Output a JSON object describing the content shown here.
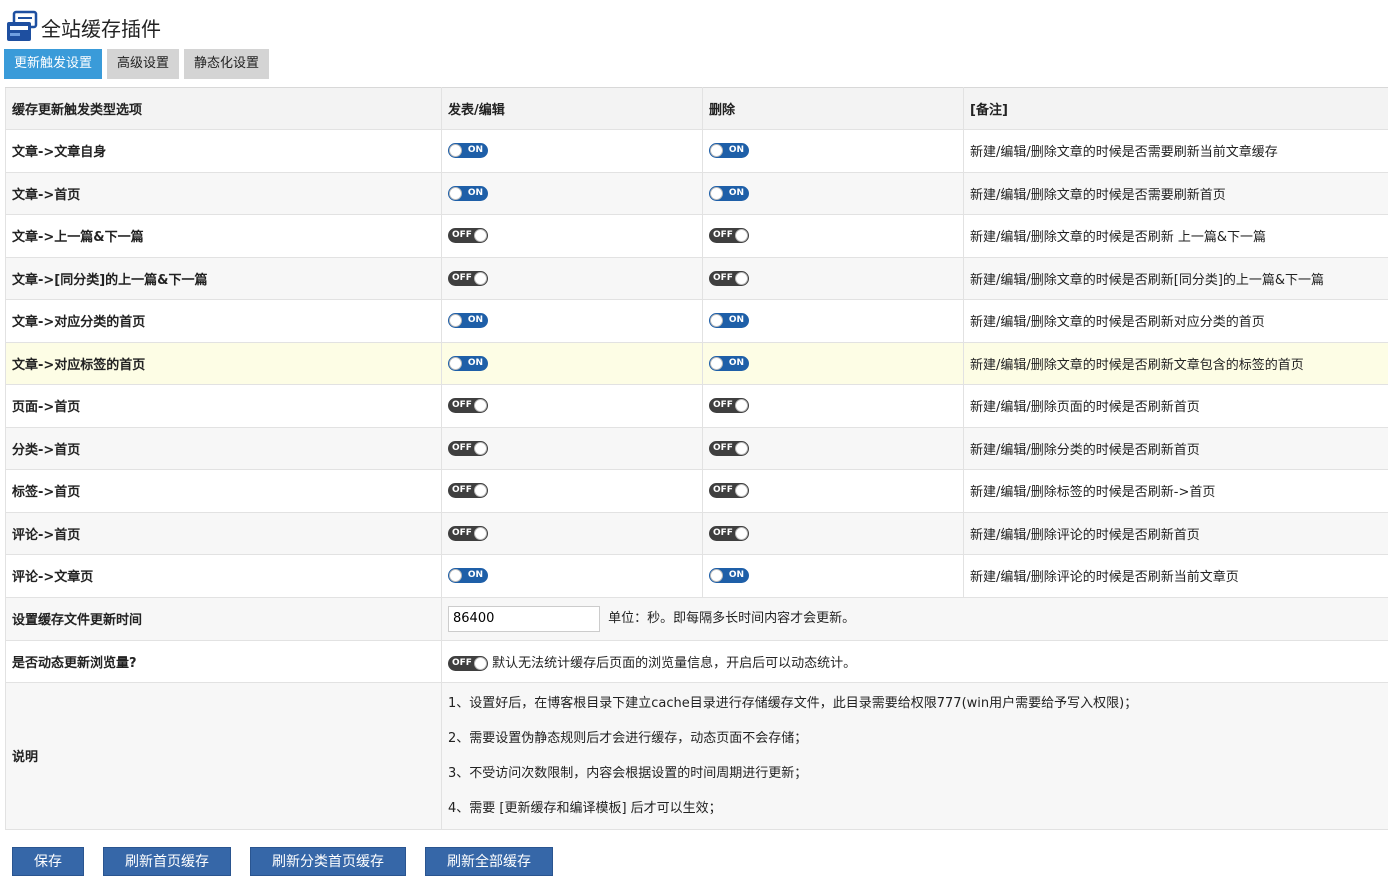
{
  "header": {
    "title": "全站缓存插件",
    "logo_icon": "cache-logo-icon"
  },
  "tabs": [
    {
      "label": "更新触发设置",
      "active": true
    },
    {
      "label": "高级设置",
      "active": false
    },
    {
      "label": "静态化设置",
      "active": false
    }
  ],
  "table": {
    "columns": [
      "缓存更新触发类型选项",
      "发表/编辑",
      "删除",
      "[备注]"
    ],
    "rows": [
      {
        "label": "文章->文章自身",
        "publish": "ON",
        "delete": "ON",
        "note": "新建/编辑/删除文章的时候是否需要刷新当前文章缓存"
      },
      {
        "label": "文章->首页",
        "publish": "ON",
        "delete": "ON",
        "note": "新建/编辑/删除文章的时候是否需要刷新首页"
      },
      {
        "label": "文章->上一篇&下一篇",
        "publish": "OFF",
        "delete": "OFF",
        "note": "新建/编辑/删除文章的时候是否刷新 上一篇&下一篇"
      },
      {
        "label": "文章->[同分类]的上一篇&下一篇",
        "publish": "OFF",
        "delete": "OFF",
        "note": "新建/编辑/删除文章的时候是否刷新[同分类]的上一篇&下一篇"
      },
      {
        "label": "文章->对应分类的首页",
        "publish": "ON",
        "delete": "ON",
        "note": "新建/编辑/删除文章的时候是否刷新对应分类的首页"
      },
      {
        "label": "文章->对应标签的首页",
        "publish": "ON",
        "delete": "ON",
        "note": "新建/编辑/删除文章的时候是否刷新文章包含的标签的首页",
        "highlight": true
      },
      {
        "label": "页面->首页",
        "publish": "OFF",
        "delete": "OFF",
        "note": "新建/编辑/删除页面的时候是否刷新首页"
      },
      {
        "label": "分类->首页",
        "publish": "OFF",
        "delete": "OFF",
        "note": "新建/编辑/删除分类的时候是否刷新首页"
      },
      {
        "label": "标签->首页",
        "publish": "OFF",
        "delete": "OFF",
        "note": "新建/编辑/删除标签的时候是否刷新->首页"
      },
      {
        "label": "评论->首页",
        "publish": "OFF",
        "delete": "OFF",
        "note": "新建/编辑/删除评论的时候是否刷新首页"
      },
      {
        "label": "评论->文章页",
        "publish": "ON",
        "delete": "ON",
        "note": "新建/编辑/删除评论的时候是否刷新当前文章页"
      }
    ]
  },
  "cache_time": {
    "label": "设置缓存文件更新时间",
    "value": "86400",
    "unit": "单位：秒。即每隔多长时间内容才会更新。"
  },
  "dynamic_views": {
    "label": "是否动态更新浏览量?",
    "state": "OFF",
    "note": "默认无法统计缓存后页面的浏览量信息，开启后可以动态统计。"
  },
  "description": {
    "label": "说明",
    "lines": [
      "1、设置好后，在博客根目录下建立cache目录进行存储缓存文件，此目录需要给权限777(win用户需要给予写入权限)；",
      "2、需要设置伪静态规则后才会进行缓存，动态页面不会存储；",
      "3、不受访问次数限制，内容会根据设置的时间周期进行更新；",
      "4、需要 [更新缓存和编译模板] 后才可以生效；"
    ]
  },
  "buttons": {
    "save": "保存",
    "refresh_home": "刷新首页缓存",
    "refresh_category": "刷新分类首页缓存",
    "refresh_all": "刷新全部缓存"
  },
  "colors": {
    "tab_active": "#3a9bd9",
    "button": "#3667a8",
    "switch_on": "#1e5fa8",
    "switch_off": "#3f3f3f",
    "highlight_row": "#fdfde5"
  }
}
